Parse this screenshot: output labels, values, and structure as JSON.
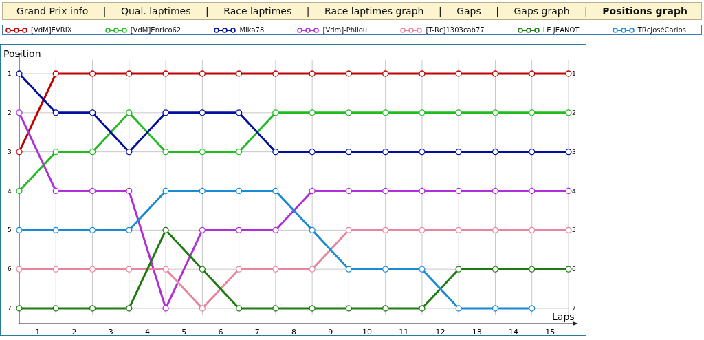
{
  "nav": {
    "separator": "|",
    "tabs": [
      {
        "label": "Grand Prix info",
        "selected": false
      },
      {
        "label": "Qual. laptimes",
        "selected": false
      },
      {
        "label": "Race laptimes",
        "selected": false
      },
      {
        "label": "Race laptimes graph",
        "selected": false
      },
      {
        "label": "Gaps",
        "selected": false
      },
      {
        "label": "Gaps graph",
        "selected": false
      },
      {
        "label": "Positions graph",
        "selected": true
      }
    ]
  },
  "chart": {
    "chart_data": {
      "type": "line",
      "xlabel": "Laps",
      "ylabel": "Position",
      "x": [
        0,
        1,
        2,
        3,
        4,
        5,
        6,
        7,
        8,
        9,
        10,
        11,
        12,
        13,
        14,
        15
      ],
      "xlim": [
        0,
        15
      ],
      "ylim": [
        7,
        1
      ],
      "xticks": [
        {
          "value": 0.5,
          "label": "1"
        },
        {
          "value": 1.5,
          "label": "2"
        },
        {
          "value": 2.5,
          "label": "3"
        },
        {
          "value": 3.5,
          "label": "4"
        },
        {
          "value": 4.5,
          "label": "5"
        },
        {
          "value": 5.5,
          "label": "6"
        },
        {
          "value": 6.5,
          "label": "7"
        },
        {
          "value": 7.5,
          "label": "8"
        },
        {
          "value": 8.5,
          "label": "9"
        },
        {
          "value": 9.5,
          "label": "10"
        },
        {
          "value": 10.5,
          "label": "11"
        },
        {
          "value": 11.5,
          "label": "12"
        },
        {
          "value": 12.5,
          "label": "13"
        },
        {
          "value": 13.5,
          "label": "14"
        },
        {
          "value": 14.5,
          "label": "15"
        }
      ],
      "yticks": [
        1,
        2,
        3,
        4,
        5,
        6,
        7
      ],
      "grid": true,
      "series": [
        {
          "name": "[VdM]EVRIX",
          "color": "#c00000",
          "values": [
            3,
            1,
            1,
            1,
            1,
            1,
            1,
            1,
            1,
            1,
            1,
            1,
            1,
            1,
            1,
            1
          ],
          "marker": "circle"
        },
        {
          "name": "[VdM]Enrico62",
          "color": "#22bb22",
          "values": [
            4,
            3,
            3,
            2,
            3,
            3,
            3,
            2,
            2,
            2,
            2,
            2,
            2,
            2,
            2,
            2
          ],
          "marker": "circle"
        },
        {
          "name": "Mika78",
          "color": "#00109c",
          "values": [
            1,
            2,
            2,
            3,
            2,
            2,
            2,
            3,
            3,
            3,
            3,
            3,
            3,
            3,
            3,
            3
          ],
          "marker": "circle"
        },
        {
          "name": "[Vdm]-Philou",
          "color": "#b030d8",
          "values": [
            2,
            4,
            4,
            4,
            7,
            5,
            5,
            5,
            4,
            4,
            4,
            4,
            4,
            4,
            4,
            4
          ],
          "marker": "circle"
        },
        {
          "name": "[T-Rc]1303cab77",
          "color": "#e8849c",
          "values": [
            6,
            6,
            6,
            6,
            6,
            7,
            6,
            6,
            6,
            5,
            5,
            5,
            5,
            5,
            5,
            5
          ],
          "marker": "circle"
        },
        {
          "name": "LE JEANOT",
          "color": "#1e7a10",
          "values": [
            7,
            7,
            7,
            7,
            5,
            6,
            7,
            7,
            7,
            7,
            7,
            7,
            6,
            6,
            6,
            6
          ],
          "marker": "circle"
        },
        {
          "name": "TRcJoséCarlos",
          "color": "#1a8ad4",
          "values": [
            5,
            5,
            5,
            5,
            4,
            4,
            4,
            4,
            5,
            6,
            6,
            6,
            7,
            7,
            7,
            null
          ],
          "marker": "circle"
        }
      ]
    },
    "left_axis_labels": [
      "1",
      "2",
      "3",
      "4",
      "5",
      "6",
      "7"
    ],
    "right_axis_labels": [
      "1",
      "2",
      "3",
      "4",
      "5",
      "6",
      "7"
    ]
  }
}
